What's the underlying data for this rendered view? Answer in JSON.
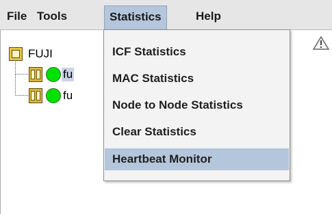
{
  "menubar": {
    "items": [
      {
        "label": "File"
      },
      {
        "label": "Tools"
      },
      {
        "label": "Statistics"
      },
      {
        "label": "Help"
      }
    ]
  },
  "tree": {
    "root_label": "FUJI",
    "children": [
      {
        "label": "fu",
        "status_color": "#00e100",
        "selected": true
      },
      {
        "label": "fu",
        "status_color": "#00e100",
        "selected": false
      }
    ]
  },
  "statistics_menu": {
    "items": [
      {
        "label": "ICF Statistics"
      },
      {
        "label": "MAC Statistics"
      },
      {
        "label": "Node to Node Statistics"
      },
      {
        "label": "Clear Statistics"
      },
      {
        "label": "Heartbeat Monitor",
        "highlighted": true
      }
    ]
  },
  "icons": {
    "root": "cluster-icon",
    "node": "node-icon",
    "status": "status-dot-icon",
    "toolbar_right": "warning-icon"
  }
}
